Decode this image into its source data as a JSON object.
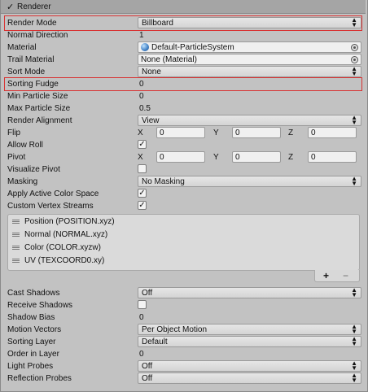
{
  "header": {
    "checked": "✓",
    "title": "Renderer"
  },
  "rows": {
    "render_mode": {
      "label": "Render Mode",
      "value": "Billboard"
    },
    "normal_direction": {
      "label": "Normal Direction",
      "value": "1"
    },
    "material": {
      "label": "Material",
      "value": "Default-ParticleSystem"
    },
    "trail_material": {
      "label": "Trail Material",
      "value": "None (Material)"
    },
    "sort_mode": {
      "label": "Sort Mode",
      "value": "None"
    },
    "sorting_fudge": {
      "label": "Sorting Fudge",
      "value": "0"
    },
    "min_particle_size": {
      "label": "Min Particle Size",
      "value": "0"
    },
    "max_particle_size": {
      "label": "Max Particle Size",
      "value": "0.5"
    },
    "render_alignment": {
      "label": "Render Alignment",
      "value": "View"
    },
    "flip": {
      "label": "Flip",
      "x_label": "X",
      "x": "0",
      "y_label": "Y",
      "y": "0",
      "z_label": "Z",
      "z": "0"
    },
    "allow_roll": {
      "label": "Allow Roll",
      "checked": "✓"
    },
    "pivot": {
      "label": "Pivot",
      "x_label": "X",
      "x": "0",
      "y_label": "Y",
      "y": "0",
      "z_label": "Z",
      "z": "0"
    },
    "visualize_pivot": {
      "label": "Visualize Pivot",
      "checked": ""
    },
    "masking": {
      "label": "Masking",
      "value": "No Masking"
    },
    "apply_active_color_space": {
      "label": "Apply Active Color Space",
      "checked": "✓"
    },
    "custom_vertex_streams": {
      "label": "Custom Vertex Streams",
      "checked": "✓"
    }
  },
  "vertex_streams": [
    "Position (POSITION.xyz)",
    "Normal (NORMAL.xyz)",
    "Color (COLOR.xyzw)",
    "UV (TEXCOORD0.xy)"
  ],
  "list_controls": {
    "add": "+",
    "remove": "−"
  },
  "rows2": {
    "cast_shadows": {
      "label": "Cast Shadows",
      "value": "Off"
    },
    "receive_shadows": {
      "label": "Receive Shadows",
      "checked": ""
    },
    "shadow_bias": {
      "label": "Shadow Bias",
      "value": "0"
    },
    "motion_vectors": {
      "label": "Motion Vectors",
      "value": "Per Object Motion"
    },
    "sorting_layer": {
      "label": "Sorting Layer",
      "value": "Default"
    },
    "order_in_layer": {
      "label": "Order in Layer",
      "value": "0"
    },
    "light_probes": {
      "label": "Light Probes",
      "value": "Off"
    },
    "reflection_probes": {
      "label": "Reflection Probes",
      "value": "Off"
    }
  },
  "colors": {
    "highlight": "#d83232",
    "background": "#c2c2c2"
  }
}
